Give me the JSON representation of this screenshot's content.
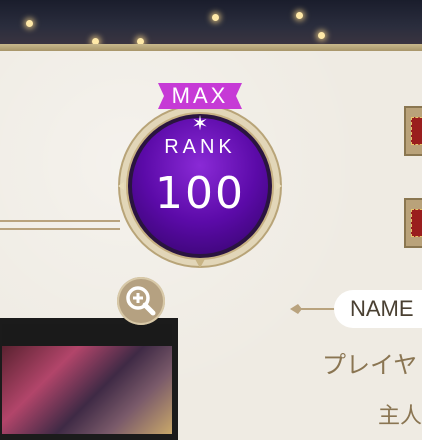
{
  "rank_badge": {
    "max_label": "MAX",
    "star_glyph": "✶",
    "rank_label": "RANK",
    "rank_value": "100",
    "colors": {
      "badge_purple": "#5b0aa8",
      "max_tag_magenta": "#c63ad6",
      "frame_gold": "#c8b485"
    }
  },
  "profile": {
    "name_tab_label": "NAME",
    "player_name_line1": "プレイヤ",
    "player_name_line2": "主人"
  },
  "icons": {
    "zoom": "zoom-in-icon",
    "tickets": "ticket-icon"
  }
}
